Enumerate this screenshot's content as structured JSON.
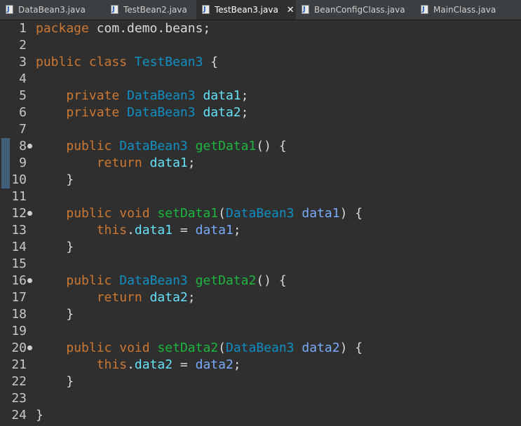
{
  "tabs": [
    {
      "label": "DataBean3.java",
      "active": false
    },
    {
      "label": "TestBean2.java",
      "active": false
    },
    {
      "label": "TestBean3.java",
      "active": true
    },
    {
      "label": "BeanConfigClass.java",
      "active": false
    },
    {
      "label": "MainClass.java",
      "active": false
    }
  ],
  "close_glyph": "✕",
  "colors": {
    "background": "#2f2f2f",
    "keyword": "#cc7832",
    "type": "#1290c3",
    "field": "#66e1f8",
    "method": "#1eb540",
    "parameter": "#79abff",
    "plain": "#d9d9d9"
  },
  "lines": [
    {
      "n": "1",
      "fold": false,
      "tokens": [
        [
          "kw",
          "package"
        ],
        [
          "pl",
          " com.demo.beans;"
        ]
      ]
    },
    {
      "n": "2",
      "fold": false,
      "tokens": []
    },
    {
      "n": "3",
      "fold": false,
      "tokens": [
        [
          "kw",
          "public"
        ],
        [
          "pl",
          " "
        ],
        [
          "kw",
          "class"
        ],
        [
          "pl",
          " "
        ],
        [
          "ty",
          "TestBean3"
        ],
        [
          "pl",
          " {"
        ]
      ]
    },
    {
      "n": "4",
      "fold": false,
      "tokens": []
    },
    {
      "n": "5",
      "fold": false,
      "tokens": [
        [
          "pl",
          "    "
        ],
        [
          "kw",
          "private"
        ],
        [
          "pl",
          " "
        ],
        [
          "ty",
          "DataBean3"
        ],
        [
          "pl",
          " "
        ],
        [
          "fd",
          "data1"
        ],
        [
          "pl",
          ";"
        ]
      ]
    },
    {
      "n": "6",
      "fold": false,
      "tokens": [
        [
          "pl",
          "    "
        ],
        [
          "kw",
          "private"
        ],
        [
          "pl",
          " "
        ],
        [
          "ty",
          "DataBean3"
        ],
        [
          "pl",
          " "
        ],
        [
          "fd",
          "data2"
        ],
        [
          "pl",
          ";"
        ]
      ]
    },
    {
      "n": "7",
      "fold": false,
      "tokens": []
    },
    {
      "n": "8",
      "fold": true,
      "tokens": [
        [
          "pl",
          "    "
        ],
        [
          "kw",
          "public"
        ],
        [
          "pl",
          " "
        ],
        [
          "ty",
          "DataBean3"
        ],
        [
          "pl",
          " "
        ],
        [
          "md",
          "getData1"
        ],
        [
          "pl",
          "() {"
        ]
      ]
    },
    {
      "n": "9",
      "fold": false,
      "tokens": [
        [
          "pl",
          "        "
        ],
        [
          "kw",
          "return"
        ],
        [
          "pl",
          " "
        ],
        [
          "fd",
          "data1"
        ],
        [
          "pl",
          ";"
        ]
      ]
    },
    {
      "n": "10",
      "fold": false,
      "tokens": [
        [
          "pl",
          "    }"
        ]
      ]
    },
    {
      "n": "11",
      "fold": false,
      "tokens": []
    },
    {
      "n": "12",
      "fold": true,
      "tokens": [
        [
          "pl",
          "    "
        ],
        [
          "kw",
          "public"
        ],
        [
          "pl",
          " "
        ],
        [
          "kw",
          "void"
        ],
        [
          "pl",
          " "
        ],
        [
          "md",
          "setData1"
        ],
        [
          "pl",
          "("
        ],
        [
          "ty",
          "DataBean3"
        ],
        [
          "pl",
          " "
        ],
        [
          "pa",
          "data1"
        ],
        [
          "pl",
          ") {"
        ]
      ]
    },
    {
      "n": "13",
      "fold": false,
      "tokens": [
        [
          "pl",
          "        "
        ],
        [
          "kw",
          "this"
        ],
        [
          "pl",
          "."
        ],
        [
          "fd",
          "data1"
        ],
        [
          "pl",
          " = "
        ],
        [
          "pa",
          "data1"
        ],
        [
          "pl",
          ";"
        ]
      ]
    },
    {
      "n": "14",
      "fold": false,
      "tokens": [
        [
          "pl",
          "    }"
        ]
      ]
    },
    {
      "n": "15",
      "fold": false,
      "tokens": []
    },
    {
      "n": "16",
      "fold": true,
      "tokens": [
        [
          "pl",
          "    "
        ],
        [
          "kw",
          "public"
        ],
        [
          "pl",
          " "
        ],
        [
          "ty",
          "DataBean3"
        ],
        [
          "pl",
          " "
        ],
        [
          "md",
          "getData2"
        ],
        [
          "pl",
          "() {"
        ]
      ]
    },
    {
      "n": "17",
      "fold": false,
      "tokens": [
        [
          "pl",
          "        "
        ],
        [
          "kw",
          "return"
        ],
        [
          "pl",
          " "
        ],
        [
          "fd",
          "data2"
        ],
        [
          "pl",
          ";"
        ]
      ]
    },
    {
      "n": "18",
      "fold": false,
      "tokens": [
        [
          "pl",
          "    }"
        ]
      ]
    },
    {
      "n": "19",
      "fold": false,
      "tokens": []
    },
    {
      "n": "20",
      "fold": true,
      "tokens": [
        [
          "pl",
          "    "
        ],
        [
          "kw",
          "public"
        ],
        [
          "pl",
          " "
        ],
        [
          "kw",
          "void"
        ],
        [
          "pl",
          " "
        ],
        [
          "md",
          "setData2"
        ],
        [
          "pl",
          "("
        ],
        [
          "ty",
          "DataBean3"
        ],
        [
          "pl",
          " "
        ],
        [
          "pa",
          "data2"
        ],
        [
          "pl",
          ") {"
        ]
      ]
    },
    {
      "n": "21",
      "fold": false,
      "tokens": [
        [
          "pl",
          "        "
        ],
        [
          "kw",
          "this"
        ],
        [
          "pl",
          "."
        ],
        [
          "fd",
          "data2"
        ],
        [
          "pl",
          " = "
        ],
        [
          "pa",
          "data2"
        ],
        [
          "pl",
          ";"
        ]
      ]
    },
    {
      "n": "22",
      "fold": false,
      "tokens": [
        [
          "pl",
          "    }"
        ]
      ]
    },
    {
      "n": "23",
      "fold": false,
      "tokens": []
    },
    {
      "n": "24",
      "fold": false,
      "tokens": [
        [
          "pl",
          "}"
        ]
      ]
    }
  ]
}
